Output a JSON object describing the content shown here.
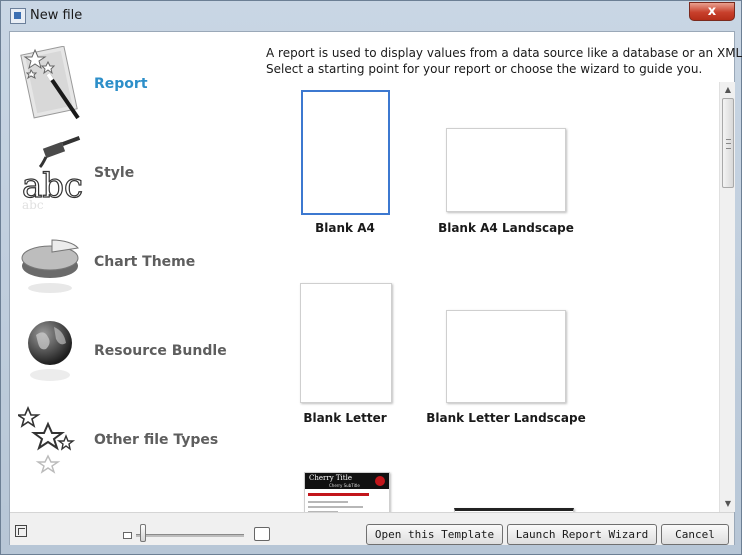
{
  "window": {
    "title": "New file",
    "close_label": "x"
  },
  "nav": {
    "items": [
      {
        "label": "Report",
        "icon": "magic-wand-page-icon",
        "active": true
      },
      {
        "label": "Style",
        "icon": "brush-letters-icon",
        "active": false
      },
      {
        "label": "Chart Theme",
        "icon": "pie-chart-icon",
        "active": false
      },
      {
        "label": "Resource Bundle",
        "icon": "globe-icon",
        "active": false
      },
      {
        "label": "Other file Types",
        "icon": "stars-icon",
        "active": false
      }
    ]
  },
  "content": {
    "description_line1": "A report is used to display values from a data source like a database or an XML file.",
    "description_line2": "Select a starting point for your report or choose the wizard to guide you.",
    "templates": [
      {
        "label": "Blank A4",
        "selected": true
      },
      {
        "label": "Blank A4 Landscape",
        "selected": false
      },
      {
        "label": "Blank Letter",
        "selected": false
      },
      {
        "label": "Blank Letter Landscape",
        "selected": false
      }
    ],
    "cherry_thumb": {
      "title": "Cherry Title",
      "subtitle": "Cherry SubTitle"
    }
  },
  "footer": {
    "open_template_label": "Open this Template",
    "launch_wizard_label": "Launch Report Wizard",
    "cancel_label": "Cancel"
  },
  "colors": {
    "active_nav": "#2d8fc9",
    "selection_border": "#3c78d0",
    "close_button": "#c8402c"
  }
}
